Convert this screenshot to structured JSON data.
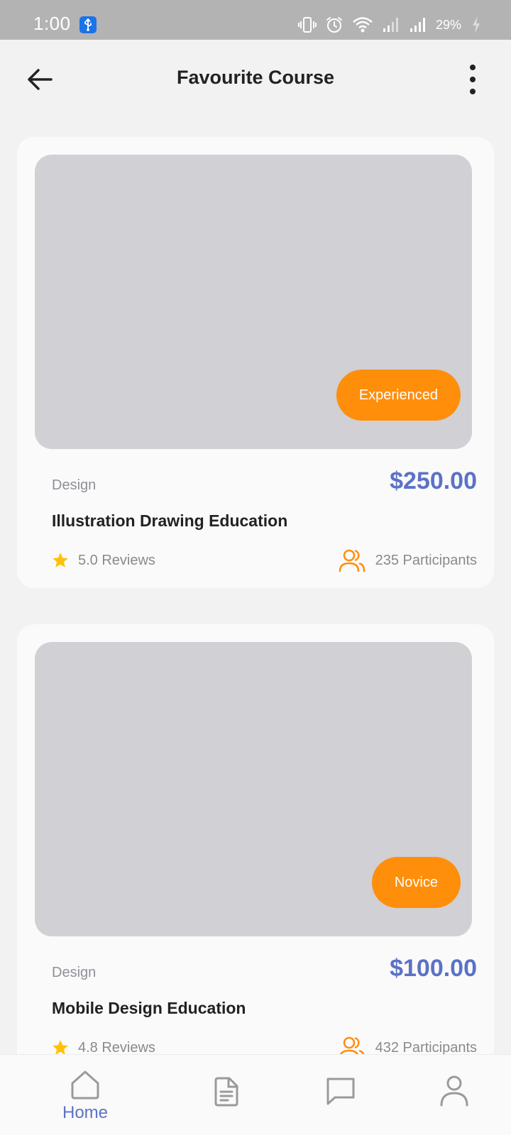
{
  "status_bar": {
    "time": "1:00",
    "battery": "29%",
    "icons": [
      "usb-icon",
      "vibrate-icon",
      "alarm-icon",
      "wifi-icon",
      "signal-icon",
      "signal-icon",
      "battery-charging-icon"
    ]
  },
  "header": {
    "title": "Favourite Course",
    "back_icon": "arrow-left-icon",
    "menu_icon": "more-vertical-icon"
  },
  "courses": [
    {
      "level": "Experienced",
      "category": "Design",
      "price": "$250.00",
      "title": "Illustration Drawing Education",
      "reviews": "5.0 Reviews",
      "participants": "235 Participants"
    },
    {
      "level": "Novice",
      "category": "Design",
      "price": "$100.00",
      "title": "Mobile Design Education",
      "reviews": "4.8 Reviews",
      "participants": "432 Participants"
    }
  ],
  "bottom_nav": {
    "items": [
      {
        "label": "Home",
        "icon": "home-icon",
        "active": true
      },
      {
        "label": "",
        "icon": "document-icon",
        "active": false
      },
      {
        "label": "",
        "icon": "chat-icon",
        "active": false
      },
      {
        "label": "",
        "icon": "user-icon",
        "active": false
      }
    ]
  },
  "colors": {
    "accent": "#5b72c6",
    "badge": "#ff8e0b",
    "star": "#ffc107",
    "status_bar": "#b3b3b3"
  }
}
